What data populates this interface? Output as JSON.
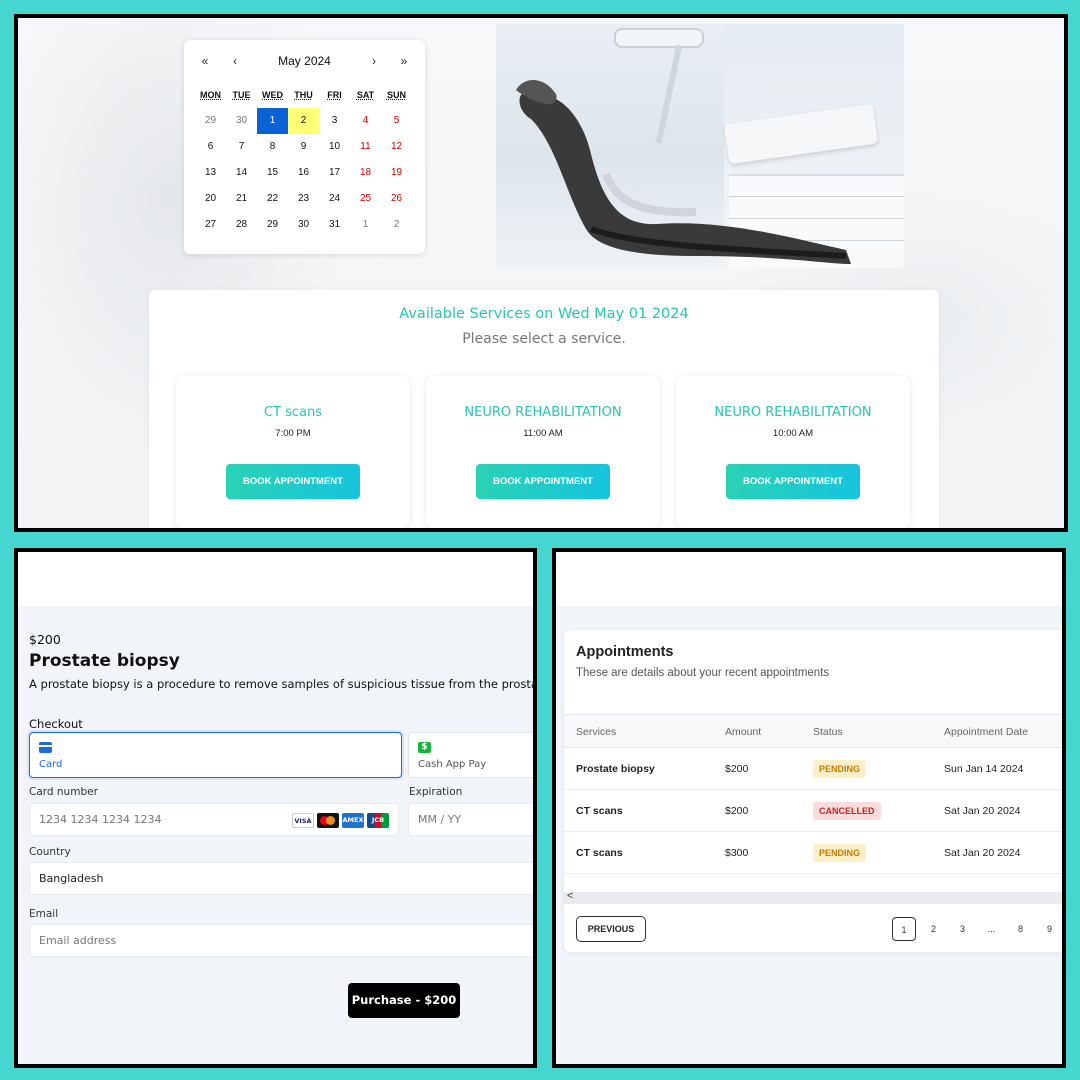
{
  "calendar": {
    "prev_year": "«",
    "prev_month": "‹",
    "month_label": "May 2024",
    "next_month": "›",
    "next_year": "»",
    "weekdays": [
      "MON",
      "TUE",
      "WED",
      "THU",
      "FRI",
      "SAT",
      "SUN"
    ],
    "weeks": [
      [
        "29",
        "30",
        "1",
        "2",
        "3",
        "4",
        "5"
      ],
      [
        "6",
        "7",
        "8",
        "9",
        "10",
        "11",
        "12"
      ],
      [
        "13",
        "14",
        "15",
        "16",
        "17",
        "18",
        "19"
      ],
      [
        "20",
        "21",
        "22",
        "23",
        "24",
        "25",
        "26"
      ],
      [
        "27",
        "28",
        "29",
        "30",
        "31",
        "1",
        "2"
      ]
    ],
    "selected_day": "1",
    "highlighted_day": "2"
  },
  "services": {
    "heading": "Available Services on Wed May 01 2024",
    "subheading": "Please select a service.",
    "items": [
      {
        "name": "CT scans",
        "time": "7:00 PM",
        "button": "BOOK APPOINTMENT"
      },
      {
        "name": "NEURO REHABILITATION",
        "time": "11:00 AM",
        "button": "BOOK APPOINTMENT"
      },
      {
        "name": "NEURO REHABILITATION",
        "time": "10:00 AM",
        "button": "BOOK APPOINTMENT"
      }
    ]
  },
  "checkout": {
    "price": "$200",
    "product_name": "Prostate biopsy",
    "description": "A prostate biopsy is a procedure to remove samples of suspicious tissue from the prostate",
    "section_label": "Checkout",
    "payment_methods": [
      {
        "label": "Card",
        "icon": "credit-card-icon"
      },
      {
        "label": "Cash App Pay",
        "icon": "cash-app-icon"
      }
    ],
    "card_number_label": "Card number",
    "card_number_placeholder": "1234 1234 1234 1234",
    "card_brands": [
      "VISA",
      "",
      "AMEX",
      "JCB"
    ],
    "expiration_label": "Expiration",
    "expiration_placeholder": "MM / YY",
    "country_label": "Country",
    "country_value": "Bangladesh",
    "email_label": "Email",
    "email_placeholder": "Email address",
    "purchase_button": "Purchase - $200"
  },
  "appointments": {
    "title": "Appointments",
    "subtitle": "These are details about your recent appointments",
    "columns": [
      "Services",
      "Amount",
      "Status",
      "Appointment Date"
    ],
    "rows": [
      {
        "service": "Prostate biopsy",
        "amount": "$200",
        "status": "PENDING",
        "date": "Sun Jan 14 2024"
      },
      {
        "service": "CT scans",
        "amount": "$200",
        "status": "CANCELLED",
        "date": "Sat Jan 20 2024"
      },
      {
        "service": "CT scans",
        "amount": "$300",
        "status": "PENDING",
        "date": "Sat Jan 20 2024"
      }
    ],
    "scroll_left": "<",
    "previous_button": "PREVIOUS",
    "pages": [
      "1",
      "2",
      "3",
      "...",
      "8",
      "9"
    ],
    "current_page": "1"
  },
  "colors": {
    "frame_bg": "#45d6cf",
    "accent_teal": "#27c4b5",
    "selected_blue": "#0a63d6",
    "highlight_yellow": "#ffff76",
    "weekend_red": "#d10000"
  }
}
